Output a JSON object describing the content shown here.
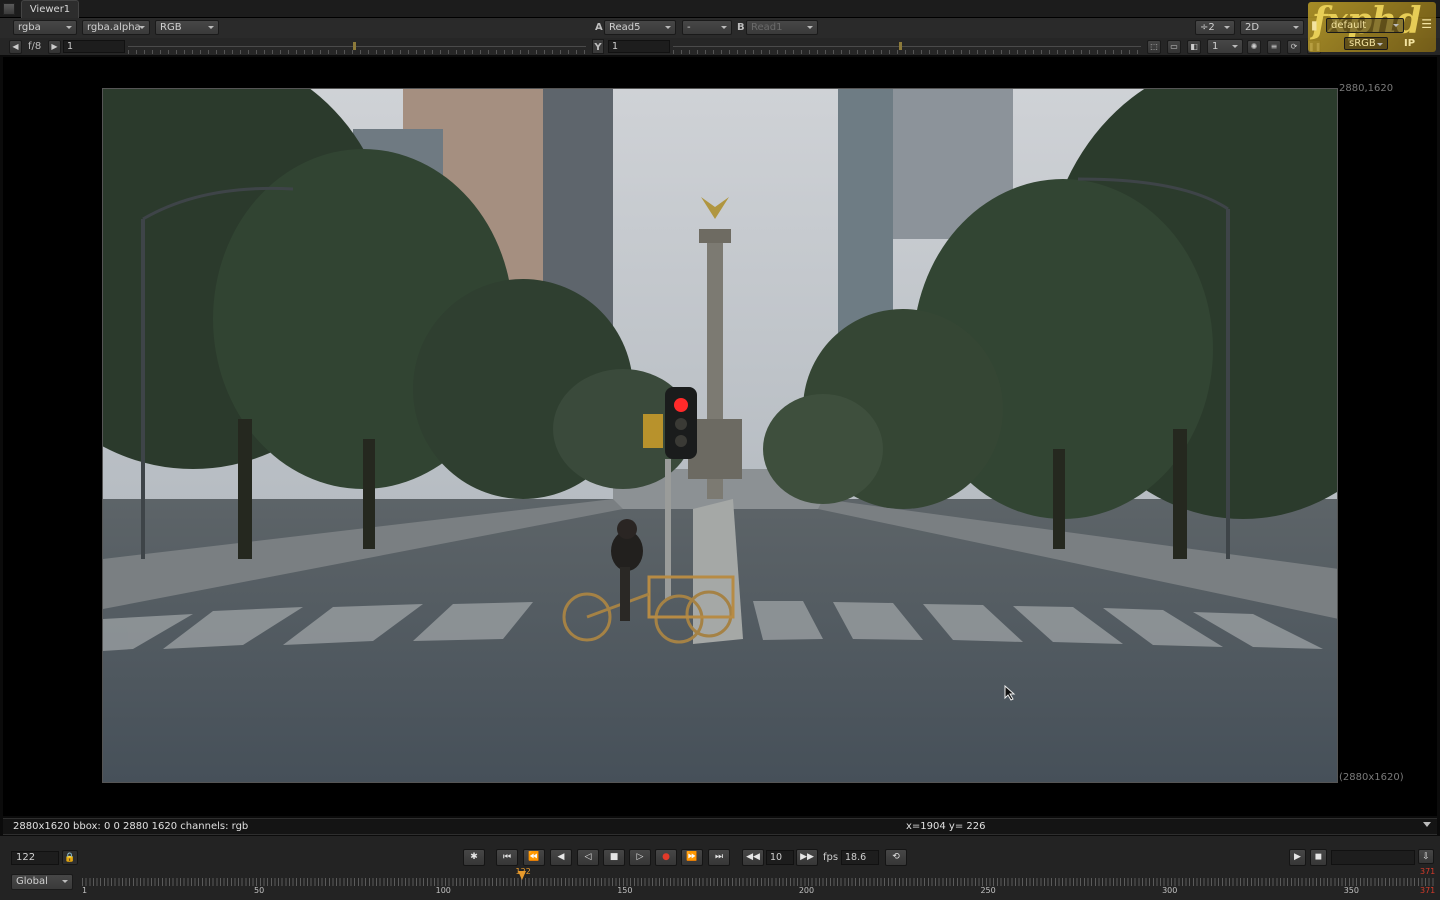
{
  "tab": {
    "label": "Viewer1"
  },
  "toolbar1": {
    "channels": "rgba",
    "alpha_channel": "rgba.alpha",
    "display_channels": "RGB",
    "input_a_label": "A",
    "input_a": "Read5",
    "composite_mode": "-",
    "input_b_label": "B",
    "input_b": "Read1",
    "downscale": "÷2",
    "view_mode": "2D",
    "viewer_process": "default"
  },
  "toolbar2": {
    "fstop": "f/8",
    "gain": "1",
    "gamma_label": "Y",
    "gamma": "1",
    "proxy": "1",
    "colorspace": "sRGB",
    "ip_label": "IP"
  },
  "logo": {
    "text": "fxphd"
  },
  "viewer": {
    "res_top_right": "2880,1620",
    "res_bottom_right": "(2880x1620)"
  },
  "infobar": {
    "left": "2880x1620 bbox: 0 0 2880 1620 channels: rgb",
    "coords": "x=1904 y= 226"
  },
  "transport": {
    "frame": "122",
    "increment": "10",
    "fps_label": "fps",
    "fps": "18.6",
    "range_mode": "Global",
    "timeline": {
      "first": 1,
      "last": 371,
      "current": 122,
      "cursor_label": "122",
      "end_label": "371",
      "ticks": [
        "1",
        "50",
        "100",
        "150",
        "200",
        "250",
        "300",
        "350",
        "371"
      ]
    }
  }
}
